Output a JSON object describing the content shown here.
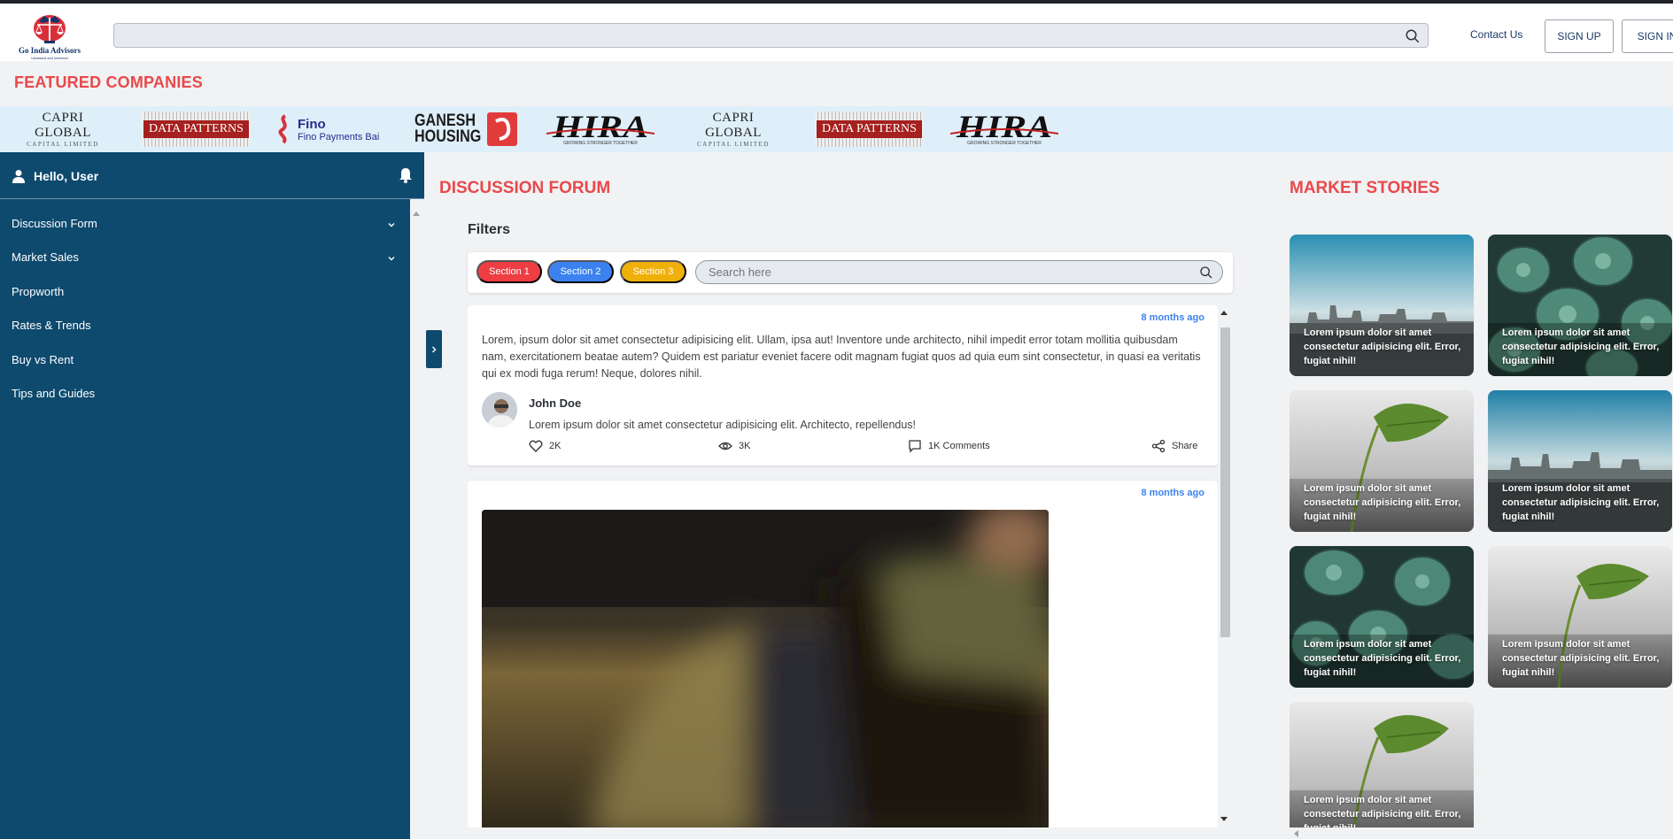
{
  "brand": {
    "name": "Go India Advisors",
    "tagline": "Unbiased and Informed"
  },
  "header": {
    "search": {
      "value": "",
      "placeholder": ""
    },
    "contact_label": "Contact Us",
    "signup_label": "SIGN UP",
    "signin_label": "SIGN IN"
  },
  "featured": {
    "title": "FEATURED COMPANIES",
    "companies": [
      {
        "name": "CAPRI GLOBAL",
        "sub": "CAPITAL LIMITED"
      },
      {
        "name": "DATA PATTERNS"
      },
      {
        "name": "Fino",
        "sub": "Fino Payments Bai"
      },
      {
        "name": "GANESH",
        "sub": "HOUSING"
      },
      {
        "name": "HIRA",
        "sub": "GROWING STRONGER TOGETHER"
      },
      {
        "name": "CAPRI GLOBAL",
        "sub": "CAPITAL LIMITED"
      },
      {
        "name": "DATA PATTERNS"
      },
      {
        "name": "HIRA",
        "sub": "GROWING STRONGER TOGETHER"
      }
    ]
  },
  "sidebar": {
    "greeting": "Hello, User",
    "items": [
      {
        "label": "Discussion Form",
        "has_children": true
      },
      {
        "label": "Market Sales",
        "has_children": true
      },
      {
        "label": "Propworth"
      },
      {
        "label": "Rates & Trends"
      },
      {
        "label": "Buy vs Rent"
      },
      {
        "label": "Tips and Guides"
      }
    ]
  },
  "forum": {
    "title": "DISCUSSION FORUM",
    "filters_label": "Filters",
    "chips": [
      "Section 1",
      "Section 2",
      "Section 3"
    ],
    "search_placeholder": "Search here",
    "posts": [
      {
        "time": "8 months ago",
        "body": "Lorem, ipsum dolor sit amet consectetur adipisicing elit. Ullam, ipsa aut! Inventore unde architecto, nihil impedit error totam mollitia quibusdam nam, exercitationem beatae autem? Quidem est pariatur eveniet facere odit magnam fugiat quos ad quia eum sint consectetur, in quasi ea veritatis qui ex modi fuga rerum! Neque, dolores nihil.",
        "author": "John Doe",
        "comment": "Lorem ipsum dolor sit amet consectetur adipisicing elit. Architecto, repellendus!",
        "likes": "2K",
        "views": "3K",
        "comments": "1K Comments",
        "share": "Share"
      },
      {
        "time": "8 months ago"
      }
    ]
  },
  "stories": {
    "title": "MARKET STORIES",
    "items": [
      {
        "image": "city-skyline",
        "text": "Lorem ipsum dolor sit amet consectetur adipisicing elit. Error, fugiat nihil!"
      },
      {
        "image": "succulents",
        "text": "Lorem ipsum dolor sit amet consectetur adipisicing elit. Error, fugiat nihil!"
      },
      {
        "image": "monstera-leaf",
        "text": "Lorem ipsum dolor sit amet consectetur adipisicing elit. Error, fugiat nihil!"
      },
      {
        "image": "city-skyline",
        "text": "Lorem ipsum dolor sit amet consectetur adipisicing elit. Error, fugiat nihil!"
      },
      {
        "image": "succulents",
        "text": "Lorem ipsum dolor sit amet consectetur adipisicing elit. Error, fugiat nihil!"
      },
      {
        "image": "monstera-leaf",
        "text": "Lorem ipsum dolor sit amet consectetur adipisicing elit. Error, fugiat nihil!"
      },
      {
        "image": "monstera-leaf",
        "text": "Lorem ipsum dolor sit amet consectetur adipisicing elit. Error, fugiat nihil!"
      }
    ]
  },
  "colors": {
    "accent_red": "#e8494b",
    "sidebar_blue": "#0e4a6e",
    "link_blue": "#3b82f0",
    "chip_yellow": "#f0b00a"
  }
}
